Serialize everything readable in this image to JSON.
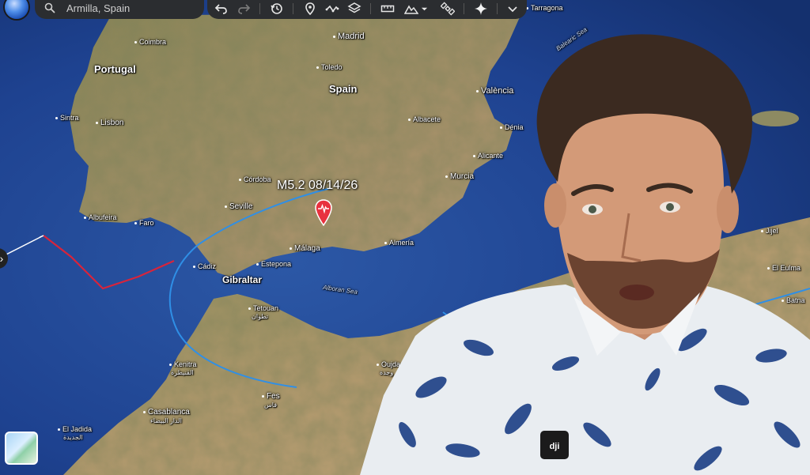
{
  "search": {
    "placeholder": "Armilla, Spain"
  },
  "toolbar": {
    "tools": [
      "undo-icon",
      "redo-icon",
      "history-icon",
      "placemark-icon",
      "path-icon",
      "layers-icon",
      "ruler-icon",
      "terrain-icon",
      "satellite-icon",
      "sparkle-icon",
      "chevron-down-icon"
    ]
  },
  "map": {
    "countries": [
      {
        "name": "Portugal"
      },
      {
        "name": "Spain"
      },
      {
        "name": "Gibraltar"
      }
    ],
    "cities": [
      {
        "name": "Coimbra"
      },
      {
        "name": "Madrid"
      },
      {
        "name": "Toledo"
      },
      {
        "name": "Tarragona"
      },
      {
        "name": "Lisbon"
      },
      {
        "name": "Sintra"
      },
      {
        "name": "València"
      },
      {
        "name": "Albacete"
      },
      {
        "name": "Dénia"
      },
      {
        "name": "Alicante"
      },
      {
        "name": "Murcia"
      },
      {
        "name": "Córdoba"
      },
      {
        "name": "Seville"
      },
      {
        "name": "Albufeira"
      },
      {
        "name": "Faro"
      },
      {
        "name": "Almería"
      },
      {
        "name": "Málaga"
      },
      {
        "name": "Estepona"
      },
      {
        "name": "Cádiz"
      },
      {
        "name": "Tetouan"
      },
      {
        "name": "Kenitra"
      },
      {
        "name": "Oujda"
      },
      {
        "name": "Fes"
      },
      {
        "name": "Casablanca"
      },
      {
        "name": "El Jadida"
      },
      {
        "name": "Jijel"
      },
      {
        "name": "El Eulma"
      },
      {
        "name": "Batna"
      }
    ],
    "seas": [
      {
        "name": "Balearic Sea"
      },
      {
        "name": "Alboran Sea"
      }
    ],
    "arabic": [
      "تطوان",
      "القنيطرة",
      "وجدة",
      "فاس",
      "الدار البيضاء",
      "الجديدة"
    ],
    "earthquake": {
      "label": "M5.2 08/14/26"
    }
  },
  "colors": {
    "fault_blue": "#2f8fe6",
    "fault_red": "#d8243b",
    "ocean": "#1f4590",
    "toolbar": "#2b2d30"
  }
}
